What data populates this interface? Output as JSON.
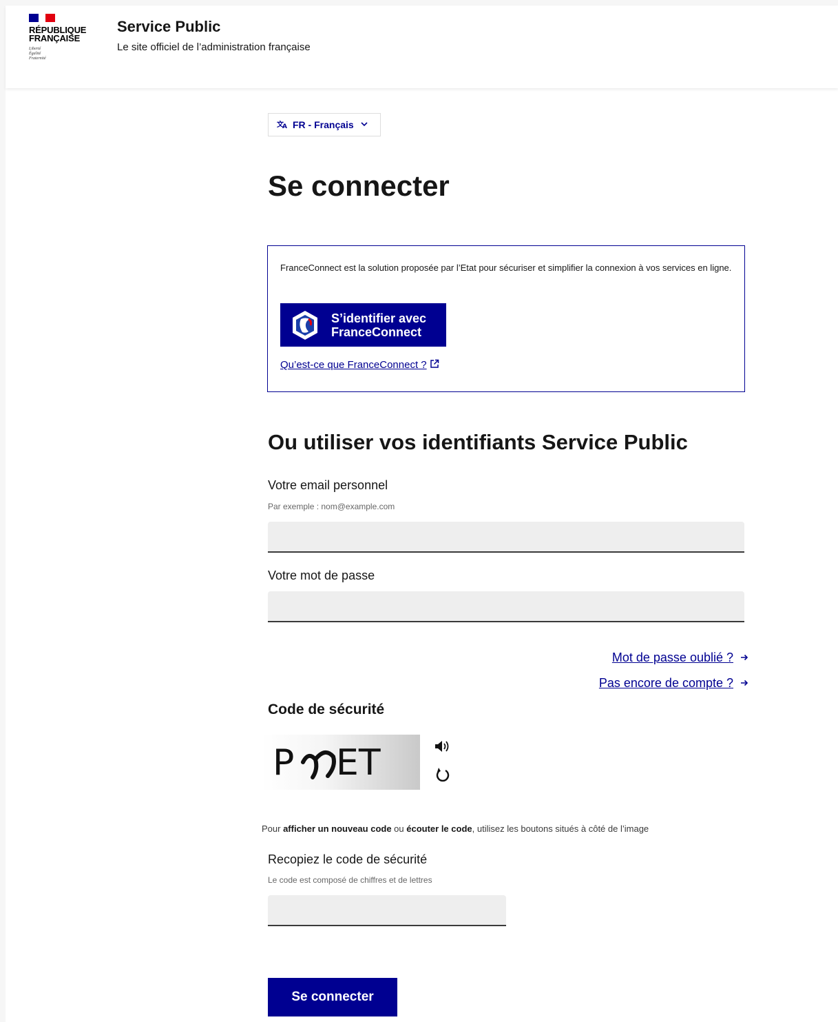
{
  "header": {
    "logo_lines": [
      "RÉPUBLIQUE",
      "FRANÇAISE"
    ],
    "motto_lines": [
      "Liberté",
      "Égalité",
      "Fraternité"
    ],
    "site_title": "Service Public",
    "tagline": "Le site officiel de l’administration française"
  },
  "language": {
    "label": "FR - Français",
    "icon": "translate-icon"
  },
  "page_title": "Se connecter",
  "franceconnect": {
    "description": "FranceConnect est la solution proposée par l’Etat pour sécuriser et simplifier la connexion à vos services en ligne.",
    "button_line1": "S’identifier avec",
    "button_line2": "FranceConnect",
    "link": "Qu’est-ce que FranceConnect ?"
  },
  "credentials": {
    "heading": "Ou utiliser vos identifiants Service Public",
    "email_label": "Votre email personnel",
    "email_hint": "Par exemple : nom@example.com",
    "email_value": "",
    "password_label": "Votre mot de passe",
    "password_value": "",
    "forgot_link": "Mot de passe oublié ?",
    "signup_link": "Pas encore de compte ?"
  },
  "captcha": {
    "heading": "Code de sécurité",
    "help_prefix": "Pour ",
    "help_bold1": "afficher un nouveau code",
    "help_mid": " ou ",
    "help_bold2": "écouter le code",
    "help_suffix": ", utilisez les boutons situés à côté de l’image",
    "input_label": "Recopiez le code de sécurité",
    "input_hint": "Le code est composé de chiffres et de lettres",
    "input_value": ""
  },
  "submit_label": "Se connecter",
  "colors": {
    "primary": "#000091",
    "text": "#161616",
    "input_bg": "#eeeeee"
  }
}
